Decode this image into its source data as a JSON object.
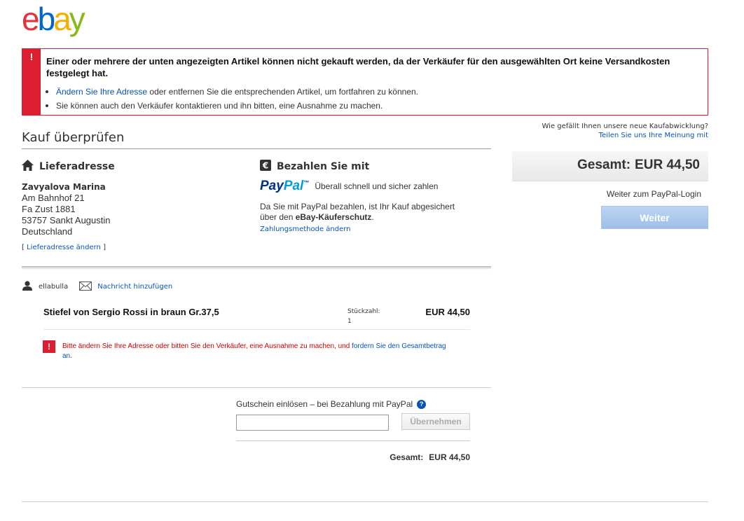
{
  "brand": {
    "logo_letters": [
      "e",
      "b",
      "a",
      "y"
    ],
    "colors": {
      "e": "#e53238",
      "b": "#0064d2",
      "a": "#f5af02",
      "y": "#86b817"
    }
  },
  "alert": {
    "icon": "!",
    "message": "Einer oder mehrere der unten angezeigten Artikel können nicht gekauft werden, da der Verkäufer für den ausgewählten Ort keine Versandkosten festgelegt hat.",
    "bullet1_link": "Ändern Sie Ihre Adresse",
    "bullet1_rest": " oder entfernen Sie die entsprechenden Artikel, um fortfahren zu können.",
    "bullet2": "Sie können auch den Verkäufer kontaktieren und ihn bitten, eine Ausnahme zu machen.",
    "color": "#dd1e31"
  },
  "page_title": "Kauf überprüfen",
  "shipping": {
    "heading": "Lieferadresse",
    "icon": "home-icon",
    "name": "Zavyalova Marina",
    "line1": "Am Bahnhof 21",
    "line2": "Fa Zust 1881",
    "line3": "53757 Sankt Augustin",
    "line4": "Deutschland",
    "change_open": "[ ",
    "change_link": "Lieferadresse ändern",
    "change_close": " ]"
  },
  "payment": {
    "heading": "Bezahlen Sie mit",
    "icon": "euro-icon",
    "paypal_logo_part1": "Pay",
    "paypal_logo_part2": "Pal",
    "paypal_tm": "™",
    "tagline": "Überall schnell und sicher zahlen",
    "info_line1": "Da Sie mit PayPal bezahlen, ist Ihr Kauf abgesichert",
    "info_line2_pre": "über den ",
    "info_line2_bold": "eBay-Käuferschutz",
    "info_line2_post": ".",
    "change_link": "Zahlungsmethode ändern"
  },
  "seller": {
    "username": "ellabulla",
    "message_link": "Nachricht hinzufügen"
  },
  "item": {
    "title": "Stiefel von Sergio Rossi in braun Gr.37,5",
    "qty_label": "Stückzahl:",
    "qty_value": "1",
    "price": "EUR 44,50",
    "error_icon": "!",
    "error_link1": "Bitte ändern Sie Ihre Adresse",
    "error_mid": " oder bitten Sie den Verkäufer, eine Ausnahme zu machen, und ",
    "error_link2": "fordern Sie den Gesamtbetrag an",
    "error_end": "."
  },
  "coupon": {
    "label": "Gutschein einlösen – bei Bezahlung mit PayPal",
    "help": "?",
    "input_value": "",
    "button": "Übernehmen"
  },
  "bottom_total": {
    "label": "Gesamt:",
    "value": "EUR 44,50"
  },
  "sidebar": {
    "feedback_question": "Wie gefällt Ihnen unsere neue Kaufabwicklung?",
    "feedback_link": "Teilen Sie uns Ihre Meinung mit",
    "total_label": "Gesamt:",
    "total_value": "EUR 44,50",
    "login_note": "Weiter zum PayPal-Login",
    "continue_button": "Weiter"
  }
}
